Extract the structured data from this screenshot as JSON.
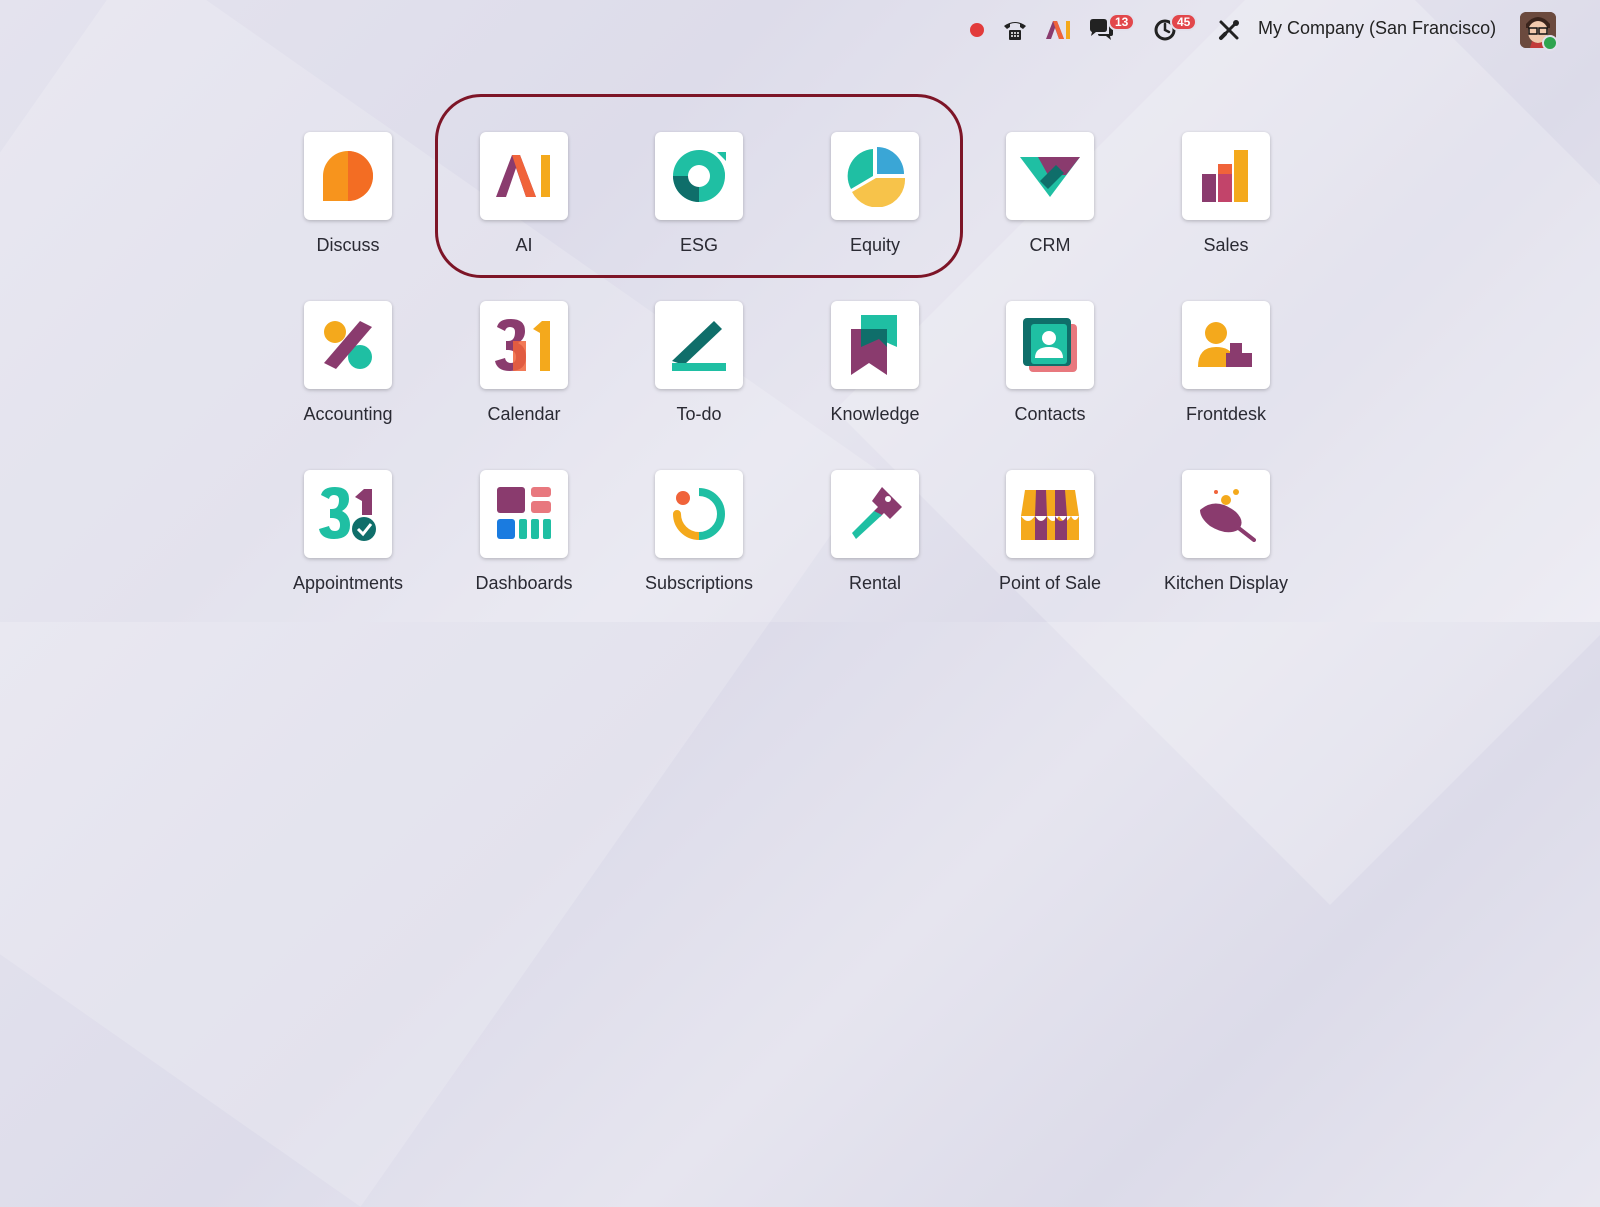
{
  "topbar": {
    "company": "My Company (San Francisco)",
    "chat_badge": "13",
    "activity_badge": "45",
    "ai_icon_text": "AI"
  },
  "apps": [
    {
      "label": "Discuss",
      "icon": "discuss-icon"
    },
    {
      "label": "AI",
      "icon": "ai-icon"
    },
    {
      "label": "ESG",
      "icon": "esg-icon"
    },
    {
      "label": "Equity",
      "icon": "equity-icon"
    },
    {
      "label": "CRM",
      "icon": "crm-icon"
    },
    {
      "label": "Sales",
      "icon": "sales-icon"
    },
    {
      "label": "Accounting",
      "icon": "accounting-icon"
    },
    {
      "label": "Calendar",
      "icon": "calendar-icon"
    },
    {
      "label": "To-do",
      "icon": "todo-icon"
    },
    {
      "label": "Knowledge",
      "icon": "knowledge-icon"
    },
    {
      "label": "Contacts",
      "icon": "contacts-icon"
    },
    {
      "label": "Frontdesk",
      "icon": "frontdesk-icon"
    },
    {
      "label": "Appointments",
      "icon": "appointments-icon"
    },
    {
      "label": "Dashboards",
      "icon": "dashboards-icon"
    },
    {
      "label": "Subscriptions",
      "icon": "subscriptions-icon"
    },
    {
      "label": "Rental",
      "icon": "rental-icon"
    },
    {
      "label": "Point of Sale",
      "icon": "point-of-sale-icon"
    },
    {
      "label": "Kitchen Display",
      "icon": "kitchen-display-icon"
    }
  ],
  "colors": {
    "highlight": "#7d1527",
    "badge": "#e2474b",
    "record": "#e23b3b",
    "online": "#2ea44f"
  }
}
